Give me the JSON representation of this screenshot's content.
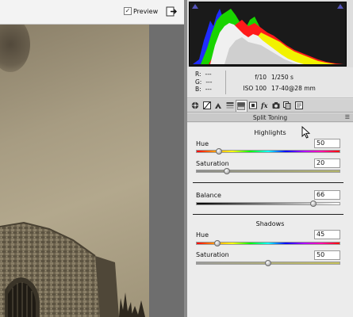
{
  "toolbar": {
    "preview_checked": true,
    "preview_check_glyph": "✓",
    "preview_label": "Preview",
    "toggle_fullscreen_icon": "fullscreen-toggle-icon"
  },
  "histogram": {
    "colors": {
      "background": "#1a1a1a"
    },
    "clipping_warning_icons": [
      "shadow-clipping-icon",
      "highlight-clipping-icon"
    ]
  },
  "readout": {
    "r_label": "R:",
    "r_value": "---",
    "g_label": "G:",
    "g_value": "---",
    "b_label": "B:",
    "b_value": "---",
    "aperture": "f/10",
    "shutter": "1/250 s",
    "iso": "ISO 100",
    "lens": "17-40@28 mm"
  },
  "tabs": [
    {
      "icon": "basic-icon"
    },
    {
      "icon": "tone-curve-icon"
    },
    {
      "icon": "detail-icon"
    },
    {
      "icon": "hsl-grayscale-icon"
    },
    {
      "icon": "split-toning-icon",
      "active": true
    },
    {
      "icon": "lens-corrections-icon"
    },
    {
      "icon": "effects-icon",
      "glyph": "fx"
    },
    {
      "icon": "camera-calibration-icon"
    },
    {
      "icon": "presets-icon"
    },
    {
      "icon": "snapshots-icon"
    }
  ],
  "section": {
    "title": "Split Toning",
    "menu_glyph": "☰"
  },
  "highlights": {
    "title": "Highlights",
    "hue": {
      "label": "Hue",
      "value": "50",
      "max": 360
    },
    "saturation": {
      "label": "Saturation",
      "value": "20",
      "max": 100
    }
  },
  "balance": {
    "label": "Balance",
    "value": "66",
    "min": -100,
    "max": 100
  },
  "shadows": {
    "title": "Shadows",
    "hue": {
      "label": "Hue",
      "value": "45",
      "max": 360
    },
    "saturation": {
      "label": "Saturation",
      "value": "50",
      "max": 100
    }
  }
}
